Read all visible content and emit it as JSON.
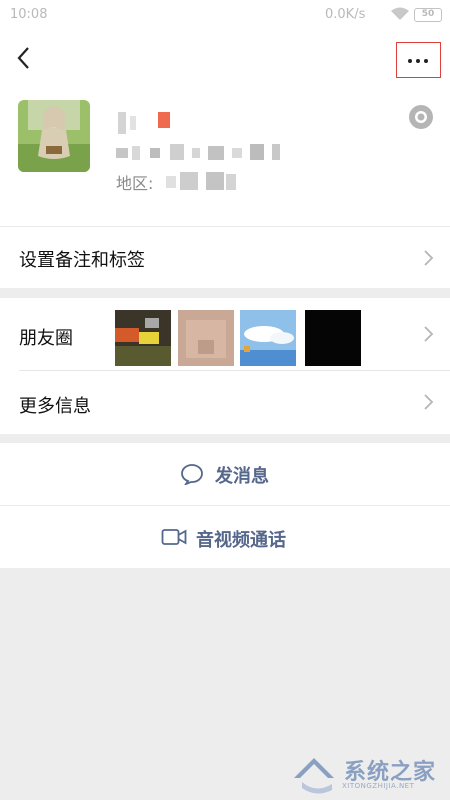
{
  "status_bar": {
    "time": "10:08",
    "net_speed": "0.0K/s",
    "battery": "50"
  },
  "nav": {
    "back_icon": "chevron-left-icon",
    "more_icon": "more-dots-icon",
    "highlight_color": "#e0403a"
  },
  "profile": {
    "region_label": "地区:",
    "camera_icon": "camera-icon"
  },
  "rows": {
    "remark_label": "设置备注和标签",
    "moments_label": "朋友圈",
    "more_info_label": "更多信息"
  },
  "actions": {
    "message_label": "发消息",
    "video_call_label": "音视频通话",
    "accent_color": "#56678c"
  },
  "watermark": {
    "text": "系统之家",
    "sub": "XITONGZHIJIA.NET"
  }
}
